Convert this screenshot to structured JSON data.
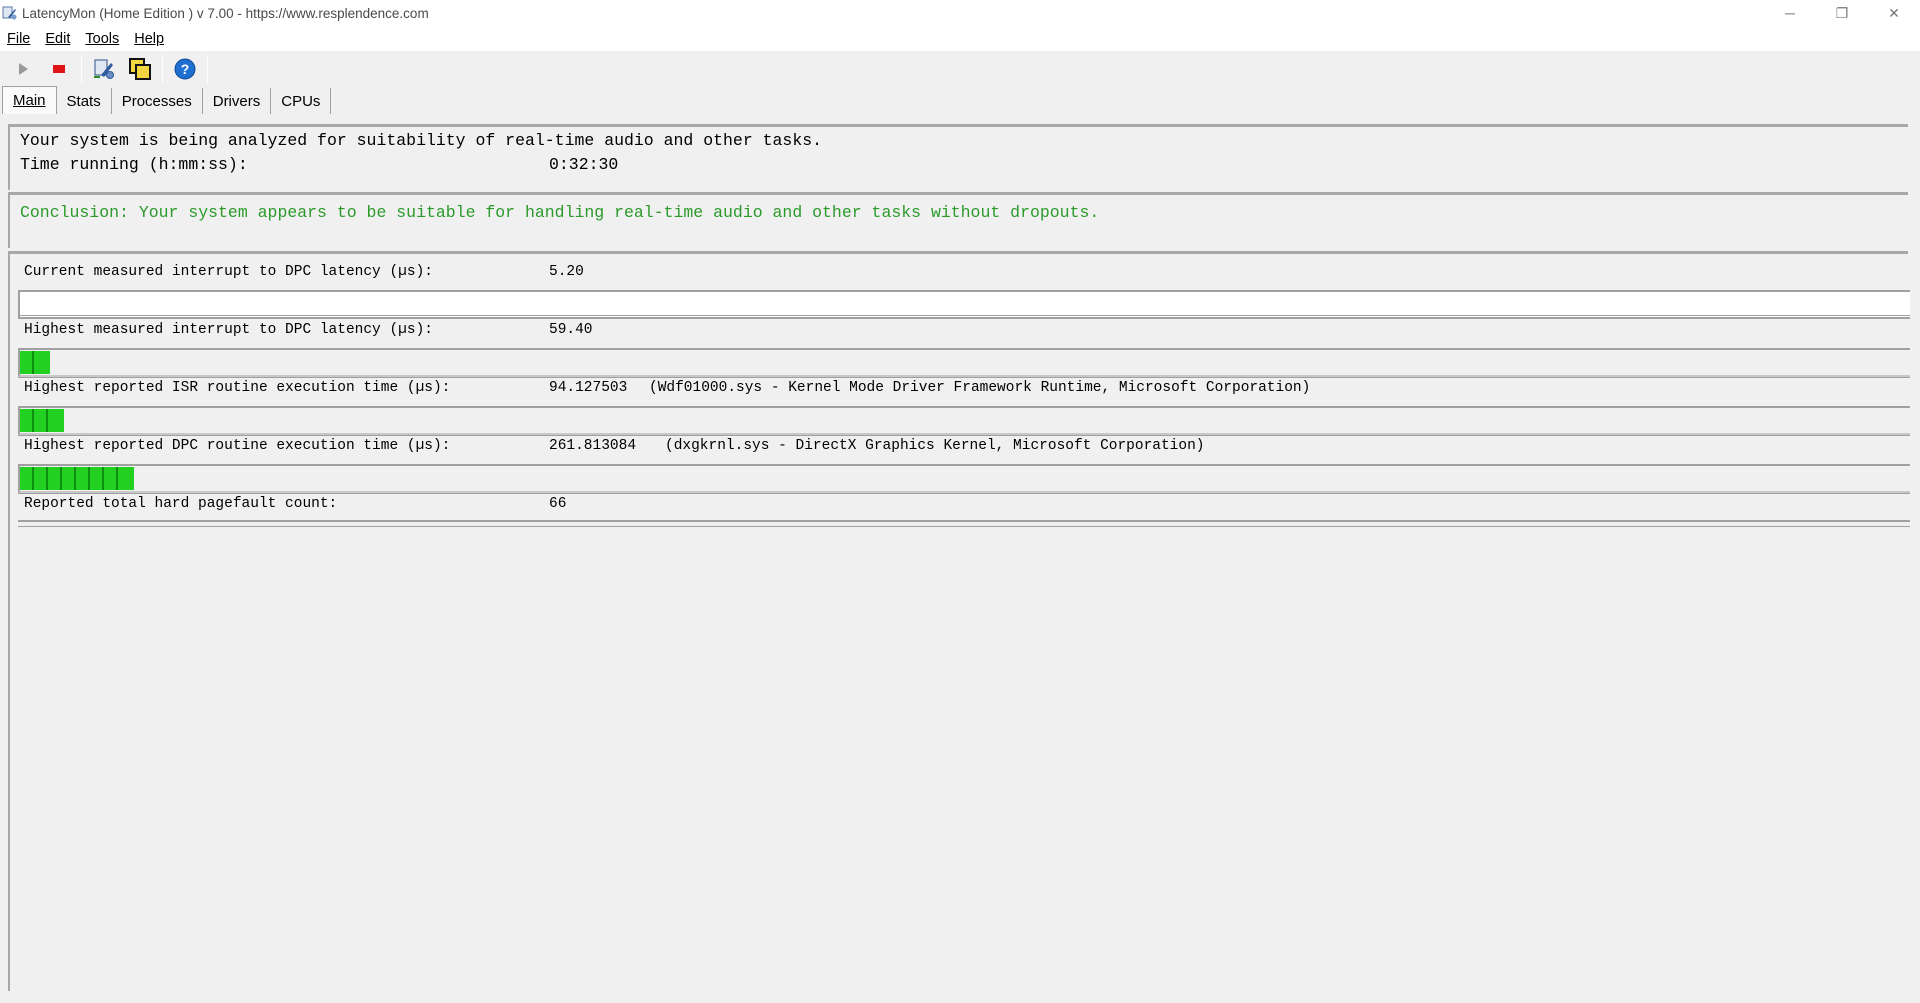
{
  "window": {
    "title": "LatencyMon  (Home Edition )  v 7.00 - https://www.resplendence.com",
    "controls": {
      "minimize": "─",
      "restore": "❐",
      "close": "✕"
    }
  },
  "menu": {
    "items": [
      {
        "label": "File"
      },
      {
        "label": "Edit"
      },
      {
        "label": "Tools"
      },
      {
        "label": "Help"
      }
    ]
  },
  "toolbar": {
    "buttons": [
      "play-icon",
      "stop-icon",
      "analyze-icon",
      "copy-windows-icon",
      "help-icon"
    ],
    "colors": {
      "stop": "#e01414",
      "help": "#1e6fd0",
      "play": "#9a9a9a"
    }
  },
  "tabs": [
    {
      "label": "Main",
      "active": true
    },
    {
      "label": "Stats",
      "active": false
    },
    {
      "label": "Processes",
      "active": false
    },
    {
      "label": "Drivers",
      "active": false
    },
    {
      "label": "CPUs",
      "active": false
    }
  ],
  "status": {
    "analyzing": "Your system is being analyzed for suitability of real-time audio and other tasks.",
    "time_label": "Time running (h:mm:ss):",
    "time_value": "0:32:30"
  },
  "conclusion": {
    "text": "Conclusion: Your system appears to be suitable for handling real-time audio and other tasks without dropouts.",
    "color": "#2b9a2b"
  },
  "metrics": {
    "current_dpc": {
      "label": "Current measured interrupt to DPC latency (µs):",
      "value": "5.20",
      "meter_segments": 0
    },
    "highest_dpc": {
      "label": "Highest measured interrupt to DPC latency (µs):",
      "value": "59.40",
      "meter_segments": 2
    },
    "isr": {
      "label": "Highest reported ISR routine execution time (µs):",
      "value": "94.127503",
      "detail": "(Wdf01000.sys - Kernel Mode Driver Framework Runtime, Microsoft Corporation)",
      "meter_segments": 3
    },
    "dpc_routine": {
      "label": "Highest reported DPC routine execution time (µs):",
      "value": "261.813084",
      "detail": "(dxgkrnl.sys - DirectX Graphics Kernel, Microsoft Corporation)",
      "meter_segments": 8
    },
    "pagefault": {
      "label": "Reported total hard pagefault count:",
      "value": "66"
    }
  },
  "meter_colors": {
    "segment": "#22d022",
    "segment_border": "#0e8e0e"
  }
}
